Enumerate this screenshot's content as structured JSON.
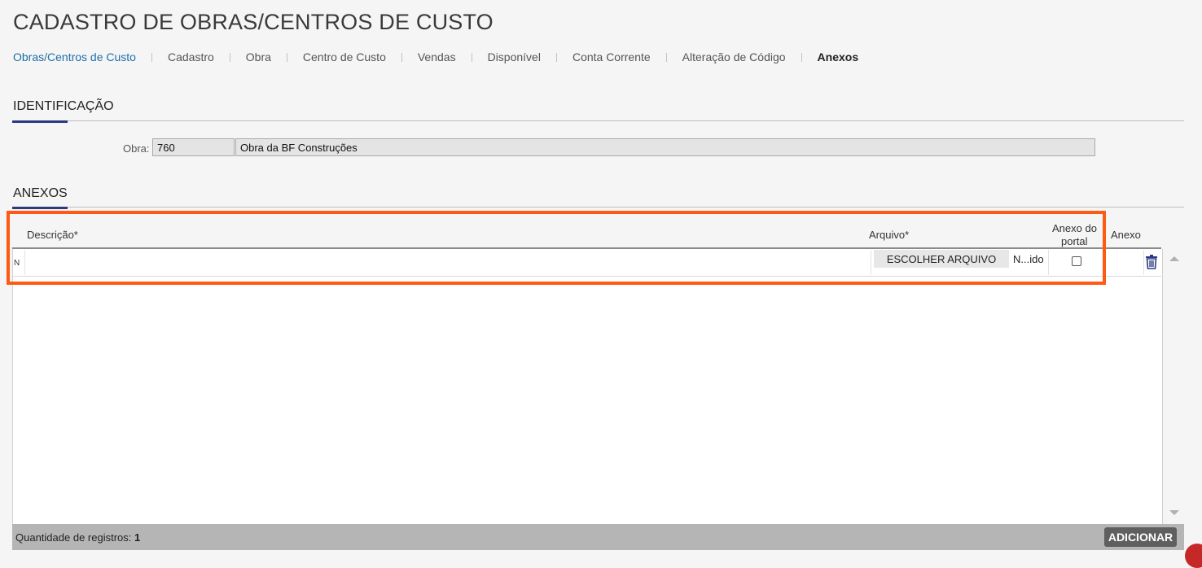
{
  "page": {
    "title": "CADASTRO DE OBRAS/CENTROS DE CUSTO"
  },
  "breadcrumb": [
    "Obras/Centros de Custo",
    "Cadastro",
    "Obra",
    "Centro de Custo",
    "Vendas",
    "Disponível",
    "Conta Corrente",
    "Alteração de Código",
    "Anexos"
  ],
  "identificacao": {
    "title": "IDENTIFICAÇÃO",
    "obra_label": "Obra:",
    "obra_code": "760",
    "obra_name": "Obra da BF Construções"
  },
  "anexos": {
    "title": "ANEXOS",
    "columns": {
      "descricao": "Descrição*",
      "arquivo": "Arquivo*",
      "anexo_portal_line1": "Anexo do",
      "anexo_portal_line2": "portal",
      "anexo": "Anexo"
    },
    "rows": [
      {
        "marker": "N",
        "descricao": "",
        "file_button": "ESCOLHER ARQUIVO",
        "file_status": "N...ido",
        "anexo_portal": false
      }
    ]
  },
  "footer": {
    "count_label": "Quantidade de registros:",
    "count_value": "1",
    "add_button": "ADICIONAR"
  },
  "colors": {
    "highlight": "#ff5a14",
    "accent": "#2b3a80",
    "link": "#1f6fa8",
    "trash": "#2b3a80"
  }
}
